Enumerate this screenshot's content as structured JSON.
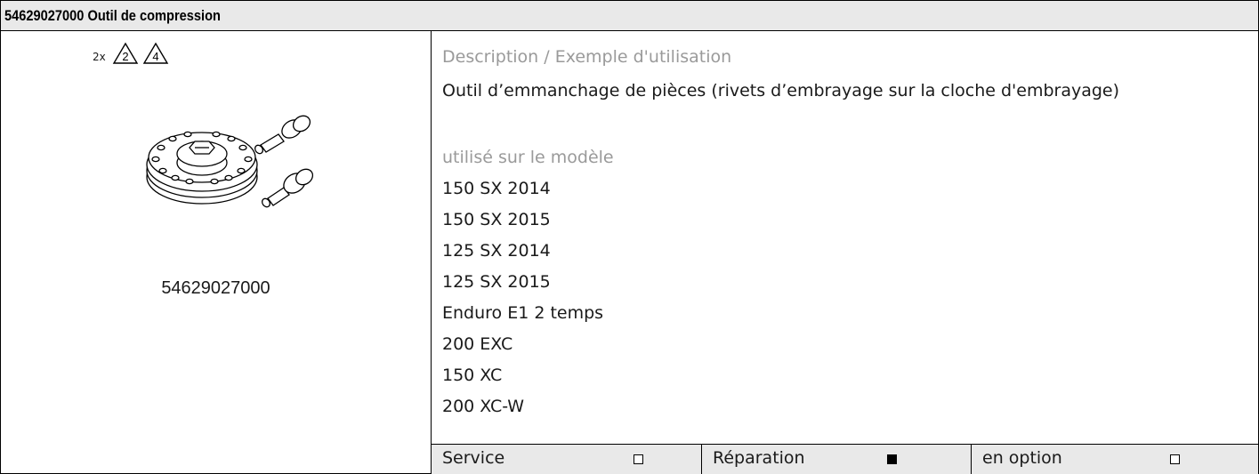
{
  "header": {
    "title": "54629027000 Outil de compression"
  },
  "left": {
    "hazard_count": "2x",
    "hazard_symbols": [
      "2",
      "4"
    ],
    "part_number": "54629027000"
  },
  "right": {
    "description_label": "Description / Exemple d'utilisation",
    "description_text": "Outil d’emmanchage de pièces (rivets d’embrayage sur la cloche d'embrayage)",
    "models_label": "utilisé sur le modèle",
    "models": [
      "150 SX 2014",
      "150 SX 2015",
      "125 SX 2014",
      "125 SX 2015",
      "Enduro E1 2 temps",
      "200 EXC",
      "150 XC",
      "200 XC-W"
    ]
  },
  "footer": {
    "service_label": "Service",
    "service_checked": false,
    "repair_label": "Réparation",
    "repair_checked": true,
    "option_label": "en option",
    "option_checked": false
  },
  "icons": {
    "hazard": "warning-triangle-icon",
    "tool": "compression-tool-illustration"
  }
}
